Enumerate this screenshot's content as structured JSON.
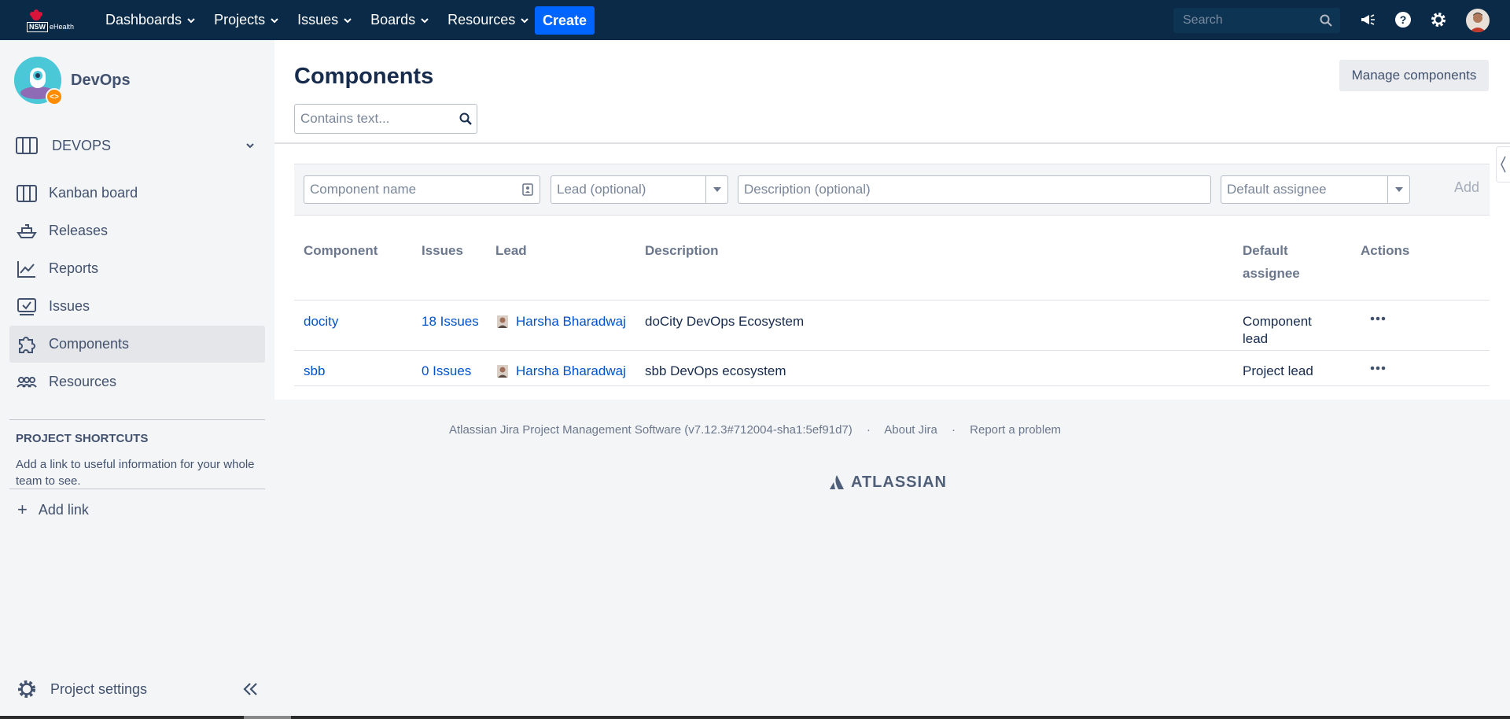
{
  "topnav": {
    "logo_text": "NSW",
    "logo_sub": "eHealth",
    "menus": [
      {
        "label": "Dashboards"
      },
      {
        "label": "Projects"
      },
      {
        "label": "Issues"
      },
      {
        "label": "Boards"
      },
      {
        "label": "Resources"
      }
    ],
    "create_label": "Create",
    "search_placeholder": "Search",
    "icons": [
      "megaphone-icon",
      "help-icon",
      "settings-icon",
      "user-avatar"
    ]
  },
  "sidebar": {
    "project_name": "DevOps",
    "project_badge": "<>",
    "board_name": "DEVOPS",
    "items": [
      {
        "label": "Kanban board",
        "icon": "kanban-icon"
      },
      {
        "label": "Releases",
        "icon": "ship-icon"
      },
      {
        "label": "Reports",
        "icon": "chart-icon"
      },
      {
        "label": "Issues",
        "icon": "issues-icon"
      },
      {
        "label": "Components",
        "icon": "puzzle-icon",
        "active": true
      },
      {
        "label": "Resources",
        "icon": "people-icon"
      }
    ],
    "shortcuts_title": "PROJECT SHORTCUTS",
    "shortcuts_desc": "Add a link to useful information for your whole team to see.",
    "add_link": "Add link",
    "project_settings": "Project settings"
  },
  "main": {
    "title": "Components",
    "manage_button": "Manage components",
    "filter_placeholder": "Contains text...",
    "form": {
      "component_name_placeholder": "Component name",
      "lead_placeholder": "Lead (optional)",
      "description_placeholder": "Description (optional)",
      "assignee_placeholder": "Default assignee",
      "add_label": "Add"
    },
    "table": {
      "headers": {
        "component": "Component",
        "issues": "Issues",
        "lead": "Lead",
        "description": "Description",
        "assignee_line1": "Default",
        "assignee_line2": "assignee",
        "actions": "Actions"
      },
      "rows": [
        {
          "component": "docity",
          "issues": "18 Issues",
          "lead": "Harsha Bharadwaj",
          "description": "doCity DevOps Ecosystem",
          "assignee_line1": "Component",
          "assignee_line2": "lead"
        },
        {
          "component": "sbb",
          "issues": "0 Issues",
          "lead": "Harsha Bharadwaj",
          "description": "sbb DevOps ecosystem",
          "assignee_line1": "Project lead",
          "assignee_line2": ""
        }
      ]
    }
  },
  "footer": {
    "version_text": "Atlassian Jira Project Management Software (v7.12.3#712004-sha1:5ef91d7)",
    "sep": "·",
    "about": "About Jira",
    "report": "Report a problem",
    "brand": "ATLASSIAN"
  },
  "colors": {
    "nav_bg": "#0a2a48",
    "create_button": "#0065ff",
    "link": "#0052cc",
    "sidebar_bg": "#f4f5f7"
  }
}
